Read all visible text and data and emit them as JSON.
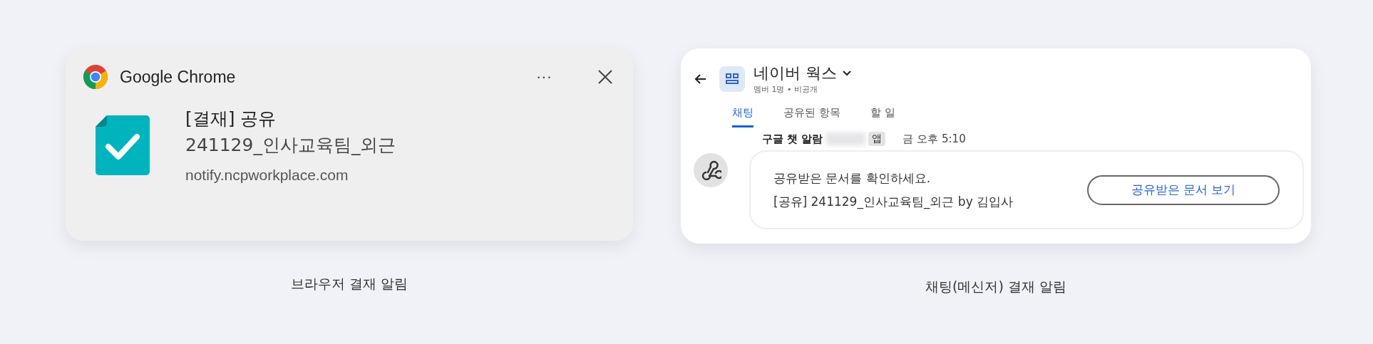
{
  "browser_notification": {
    "app_name": "Google Chrome",
    "more_label": "···",
    "title": "[결재] 공유",
    "body": "241129_인사교육팀_외근",
    "source": "notify.ncpworkplace.com",
    "caption": "브라우저 결재 알림"
  },
  "chat_notification": {
    "space_title": "네이버 웍스",
    "space_meta": "멤버 1명 • 비공개",
    "tabs": [
      {
        "label": "채팅",
        "selected": true
      },
      {
        "label": "공유된 항목",
        "selected": false
      },
      {
        "label": "할 일",
        "selected": false
      }
    ],
    "sender": "구글 챗 알람",
    "sender_badge": "앱",
    "time": "금 오후 5:10",
    "message_lines": [
      "공유받은 문서를 확인하세요.",
      "[공유] 241129_인사교육팀_외근 by 김입사"
    ],
    "action_button": "공유받은 문서 보기",
    "caption": "채팅(메신저) 결재 알림"
  }
}
